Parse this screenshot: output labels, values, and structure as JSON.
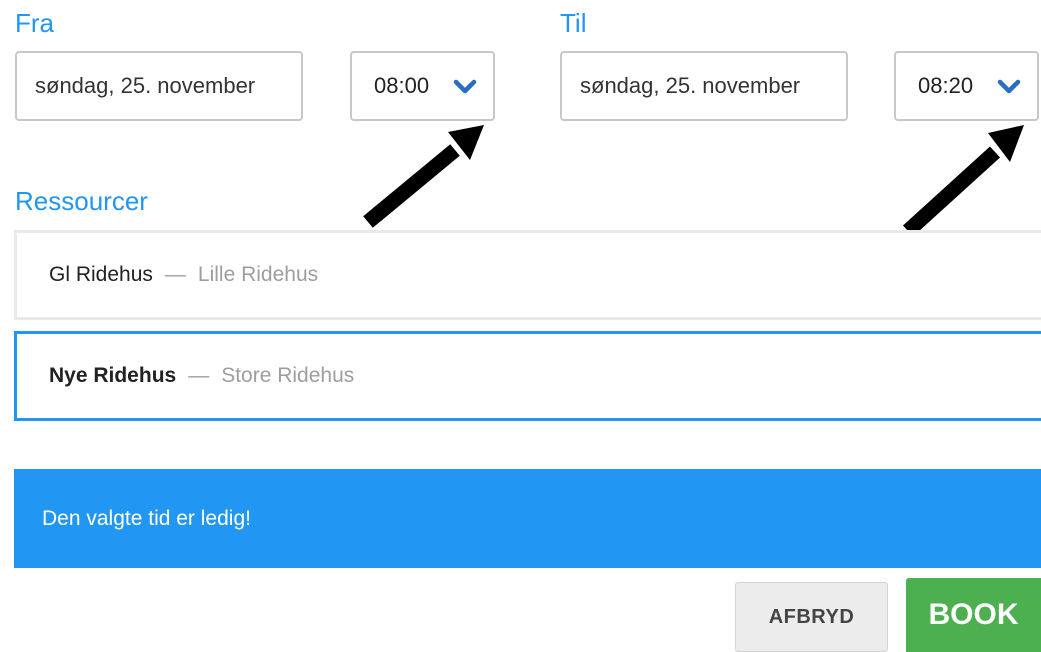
{
  "from": {
    "label": "Fra",
    "date": "søndag, 25. november",
    "time": "08:00"
  },
  "to": {
    "label": "Til",
    "date": "søndag, 25. november",
    "time": "08:20"
  },
  "resources": {
    "label": "Ressourcer",
    "items": [
      {
        "name": "Gl Ridehus",
        "separator": "—",
        "subtitle": "Lille Ridehus",
        "selected": false
      },
      {
        "name": "Nye Ridehus",
        "separator": "—",
        "subtitle": "Store Ridehus",
        "selected": true
      }
    ]
  },
  "status_banner": {
    "text": "Den valgte tid er ledig!"
  },
  "buttons": {
    "cancel_label": "AFBRYD",
    "book_label": "BOOK"
  },
  "colors": {
    "accent": "#2196f3",
    "book": "#4caf50",
    "annotation_arrow": "#000000"
  },
  "icons": {
    "dropdown": "chevron-down-icon",
    "annotation": "arrow-icon"
  }
}
